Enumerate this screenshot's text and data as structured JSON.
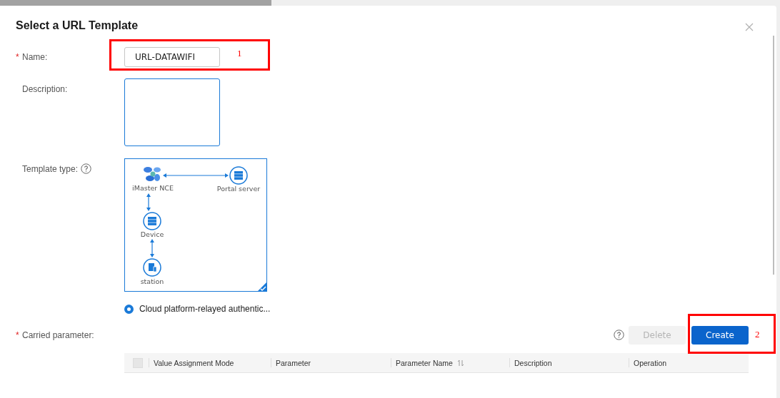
{
  "dialog": {
    "title": "Select a URL Template"
  },
  "fields": {
    "name": {
      "required_mark": "*",
      "label": "Name:",
      "value": "URL-DATAWIFI"
    },
    "description": {
      "label": "Description:"
    },
    "template_type": {
      "label": "Template type:",
      "templates": [
        {
          "selected": true,
          "nodes": [
            {
              "kind": "nce",
              "label": "iMaster NCE"
            },
            {
              "kind": "server",
              "label": "Portal server"
            },
            {
              "kind": "device",
              "label": "Device"
            },
            {
              "kind": "station",
              "label": "station"
            }
          ],
          "option": {
            "label": "Cloud platform-relayed authentic...",
            "selected": true
          }
        }
      ]
    },
    "carried_parameter": {
      "required_mark": "*",
      "label": "Carried parameter:"
    }
  },
  "toolbar": {
    "buttons": [
      {
        "kind": "secondary",
        "label": "Delete",
        "disabled": true
      },
      {
        "kind": "primary",
        "label": "Create",
        "disabled": false
      }
    ]
  },
  "table": {
    "select_all": {
      "checked": false
    },
    "columns": [
      {
        "label": "Value Assignment Mode",
        "sortable": false
      },
      {
        "label": "Parameter",
        "sortable": false
      },
      {
        "label": "Parameter Name",
        "sortable": true
      },
      {
        "label": "Description",
        "sortable": false
      },
      {
        "label": "Operation",
        "sortable": false
      }
    ]
  },
  "annotations": [
    {
      "label": "1"
    },
    {
      "label": "2"
    }
  ]
}
